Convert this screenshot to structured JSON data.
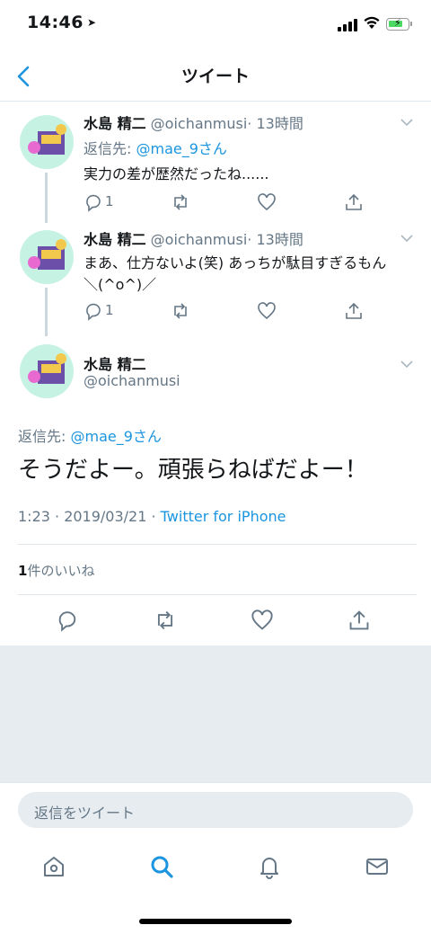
{
  "status": {
    "time": "14:46"
  },
  "nav": {
    "title": "ツイート"
  },
  "tweets": [
    {
      "name": "水島 精二",
      "handle": "@oichanmusi",
      "time": "· 13時間",
      "reply_prefix": "返信先: ",
      "reply_to": "@mae_9さん",
      "text": "実力の差が歴然だったね......",
      "reply_count": "1"
    },
    {
      "name": "水島 精二",
      "handle": "@oichanmusi",
      "time": "· 13時間",
      "text_line1": "まあ、仕方ないよ(笑) あっちが駄目すぎるもん",
      "text_line2": "＼(^o^)／",
      "reply_count": "1"
    }
  ],
  "main_tweet": {
    "name": "水島 精二",
    "handle": "@oichanmusi",
    "reply_prefix": "返信先: ",
    "reply_to": "@mae_9さん",
    "text": "そうだよー。頑張らねばだよー！",
    "timestamp": "1:23 · 2019/03/21 · ",
    "source": "Twitter for iPhone",
    "likes_count": "1",
    "likes_label": "件のいいね"
  },
  "reply_bar": {
    "placeholder": "返信をツイート"
  },
  "tab_bar": [
    "home-icon",
    "search-icon",
    "notifications-icon",
    "messages-icon"
  ],
  "colors": {
    "accent": "#1b95e0",
    "secondary": "#657786",
    "divider": "#e1e8ed",
    "background_gray": "#e6ecf0"
  }
}
